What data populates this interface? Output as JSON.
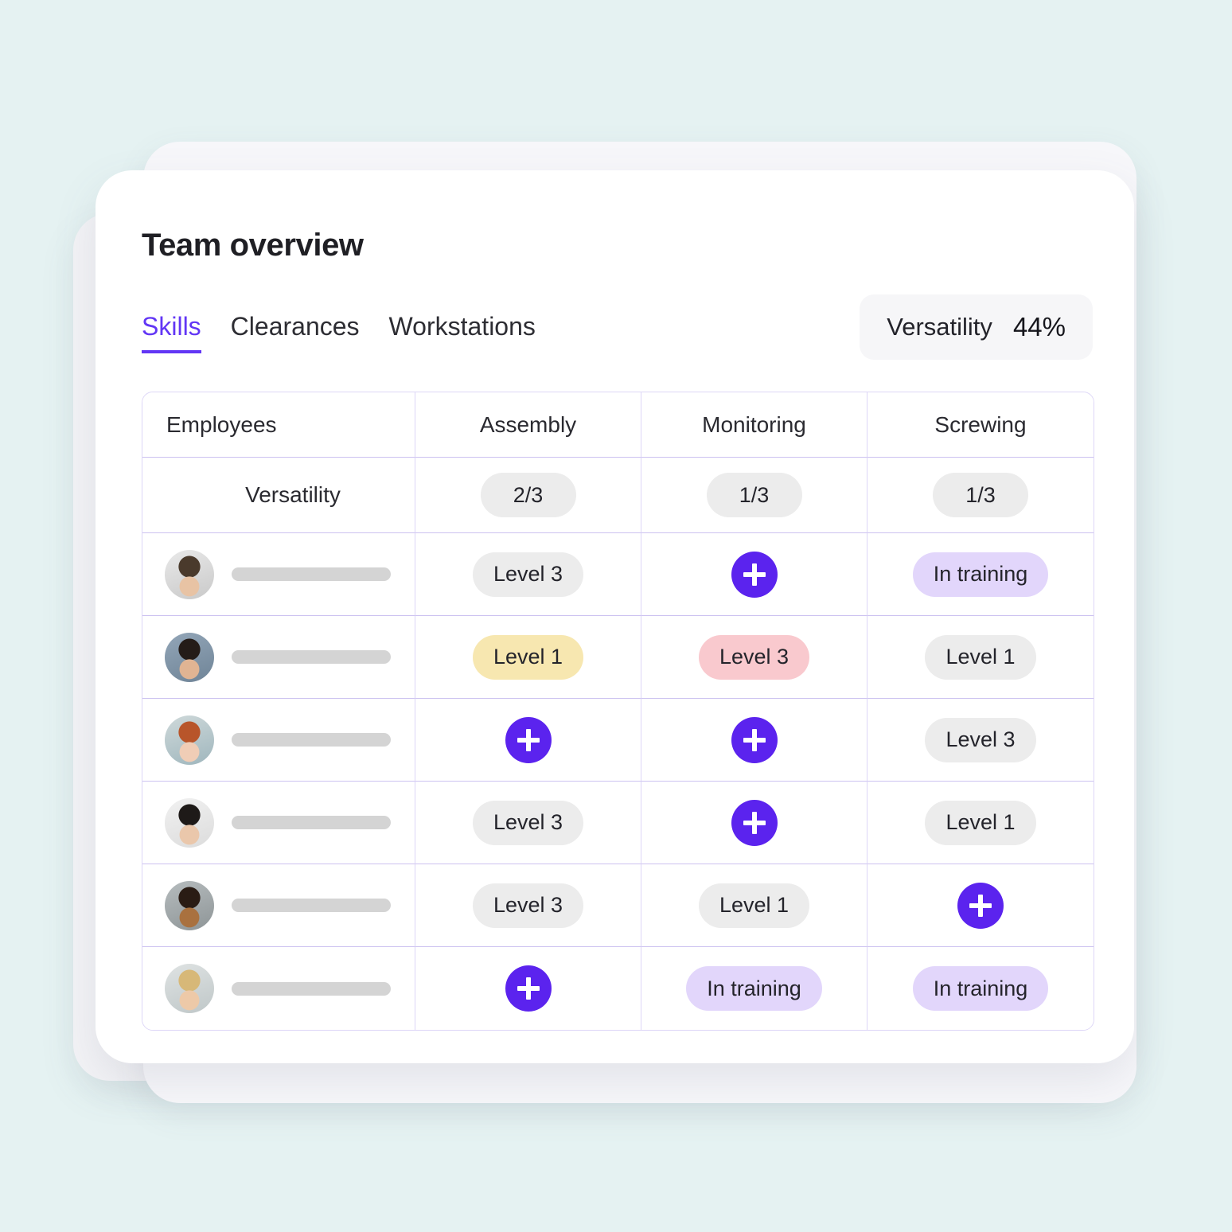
{
  "header": {
    "title": "Team overview"
  },
  "tabs": [
    {
      "label": "Skills",
      "active": true
    },
    {
      "label": "Clearances",
      "active": false
    },
    {
      "label": "Workstations",
      "active": false
    }
  ],
  "versatility_chip": {
    "label": "Versatility",
    "value": "44%"
  },
  "table": {
    "columns": [
      "Employees",
      "Assembly",
      "Monitoring",
      "Screwing"
    ],
    "versatility_row": {
      "label": "Versatility",
      "values": [
        "2/3",
        "1/3",
        "1/3"
      ]
    },
    "rows": [
      {
        "avatar": "avatar-employee-1",
        "name_placeholder": "",
        "cells": [
          {
            "type": "pill",
            "style": "grey",
            "text": "Level 3"
          },
          {
            "type": "add",
            "style": "purple",
            "text": "+"
          },
          {
            "type": "pill",
            "style": "lilac",
            "text": "In training"
          }
        ]
      },
      {
        "avatar": "avatar-employee-2",
        "name_placeholder": "",
        "cells": [
          {
            "type": "pill",
            "style": "yellow",
            "text": "Level 1"
          },
          {
            "type": "pill",
            "style": "pink",
            "text": "Level 3"
          },
          {
            "type": "pill",
            "style": "grey",
            "text": "Level 1"
          }
        ]
      },
      {
        "avatar": "avatar-employee-3",
        "name_placeholder": "",
        "cells": [
          {
            "type": "add",
            "style": "purple",
            "text": "+"
          },
          {
            "type": "add",
            "style": "purple",
            "text": "+"
          },
          {
            "type": "pill",
            "style": "grey",
            "text": "Level 3"
          }
        ]
      },
      {
        "avatar": "avatar-employee-4",
        "name_placeholder": "",
        "cells": [
          {
            "type": "pill",
            "style": "grey",
            "text": "Level 3"
          },
          {
            "type": "add",
            "style": "purple",
            "text": "+"
          },
          {
            "type": "pill",
            "style": "grey",
            "text": "Level 1"
          }
        ]
      },
      {
        "avatar": "avatar-employee-5",
        "name_placeholder": "",
        "cells": [
          {
            "type": "pill",
            "style": "grey",
            "text": "Level 3"
          },
          {
            "type": "pill",
            "style": "grey",
            "text": "Level 1"
          },
          {
            "type": "add",
            "style": "purple",
            "text": "+"
          }
        ]
      },
      {
        "avatar": "avatar-employee-6",
        "name_placeholder": "",
        "cells": [
          {
            "type": "add",
            "style": "purple",
            "text": "+"
          },
          {
            "type": "pill",
            "style": "lilac",
            "text": "In training"
          },
          {
            "type": "pill",
            "style": "lilac",
            "text": "In training"
          }
        ]
      }
    ]
  },
  "colors": {
    "page_background": "#e5f2f2",
    "accent_purple": "#6236f5",
    "add_button_purple": "#5b23ee",
    "pill_grey": "#ececec",
    "pill_yellow": "#f7e7b0",
    "pill_pink": "#f9c9ce",
    "pill_lilac": "#e2d6fb",
    "table_border": "#ddd6f7",
    "row_divider": "#ccc2f0",
    "card_white": "#ffffff"
  },
  "avatar_tones": {
    "avatar-employee-1": [
      "#e9e9e9",
      "#c9c9c9",
      "#4a3a2c",
      "#e8c3a4"
    ],
    "avatar-employee-2": [
      "#93a6b8",
      "#6f8497",
      "#241c18",
      "#e0b493"
    ],
    "avatar-employee-3": [
      "#cfd9da",
      "#9fb6bd",
      "#b8552a",
      "#f0cdb6"
    ],
    "avatar-employee-4": [
      "#f1f1f1",
      "#dcdcdc",
      "#1e1a18",
      "#eac7ab"
    ],
    "avatar-employee-5": [
      "#b6bcbe",
      "#8e9597",
      "#2a1c14",
      "#a9713f"
    ],
    "avatar-employee-6": [
      "#dfe3e3",
      "#bfc7c8",
      "#d7b878",
      "#edc9a8"
    ]
  }
}
